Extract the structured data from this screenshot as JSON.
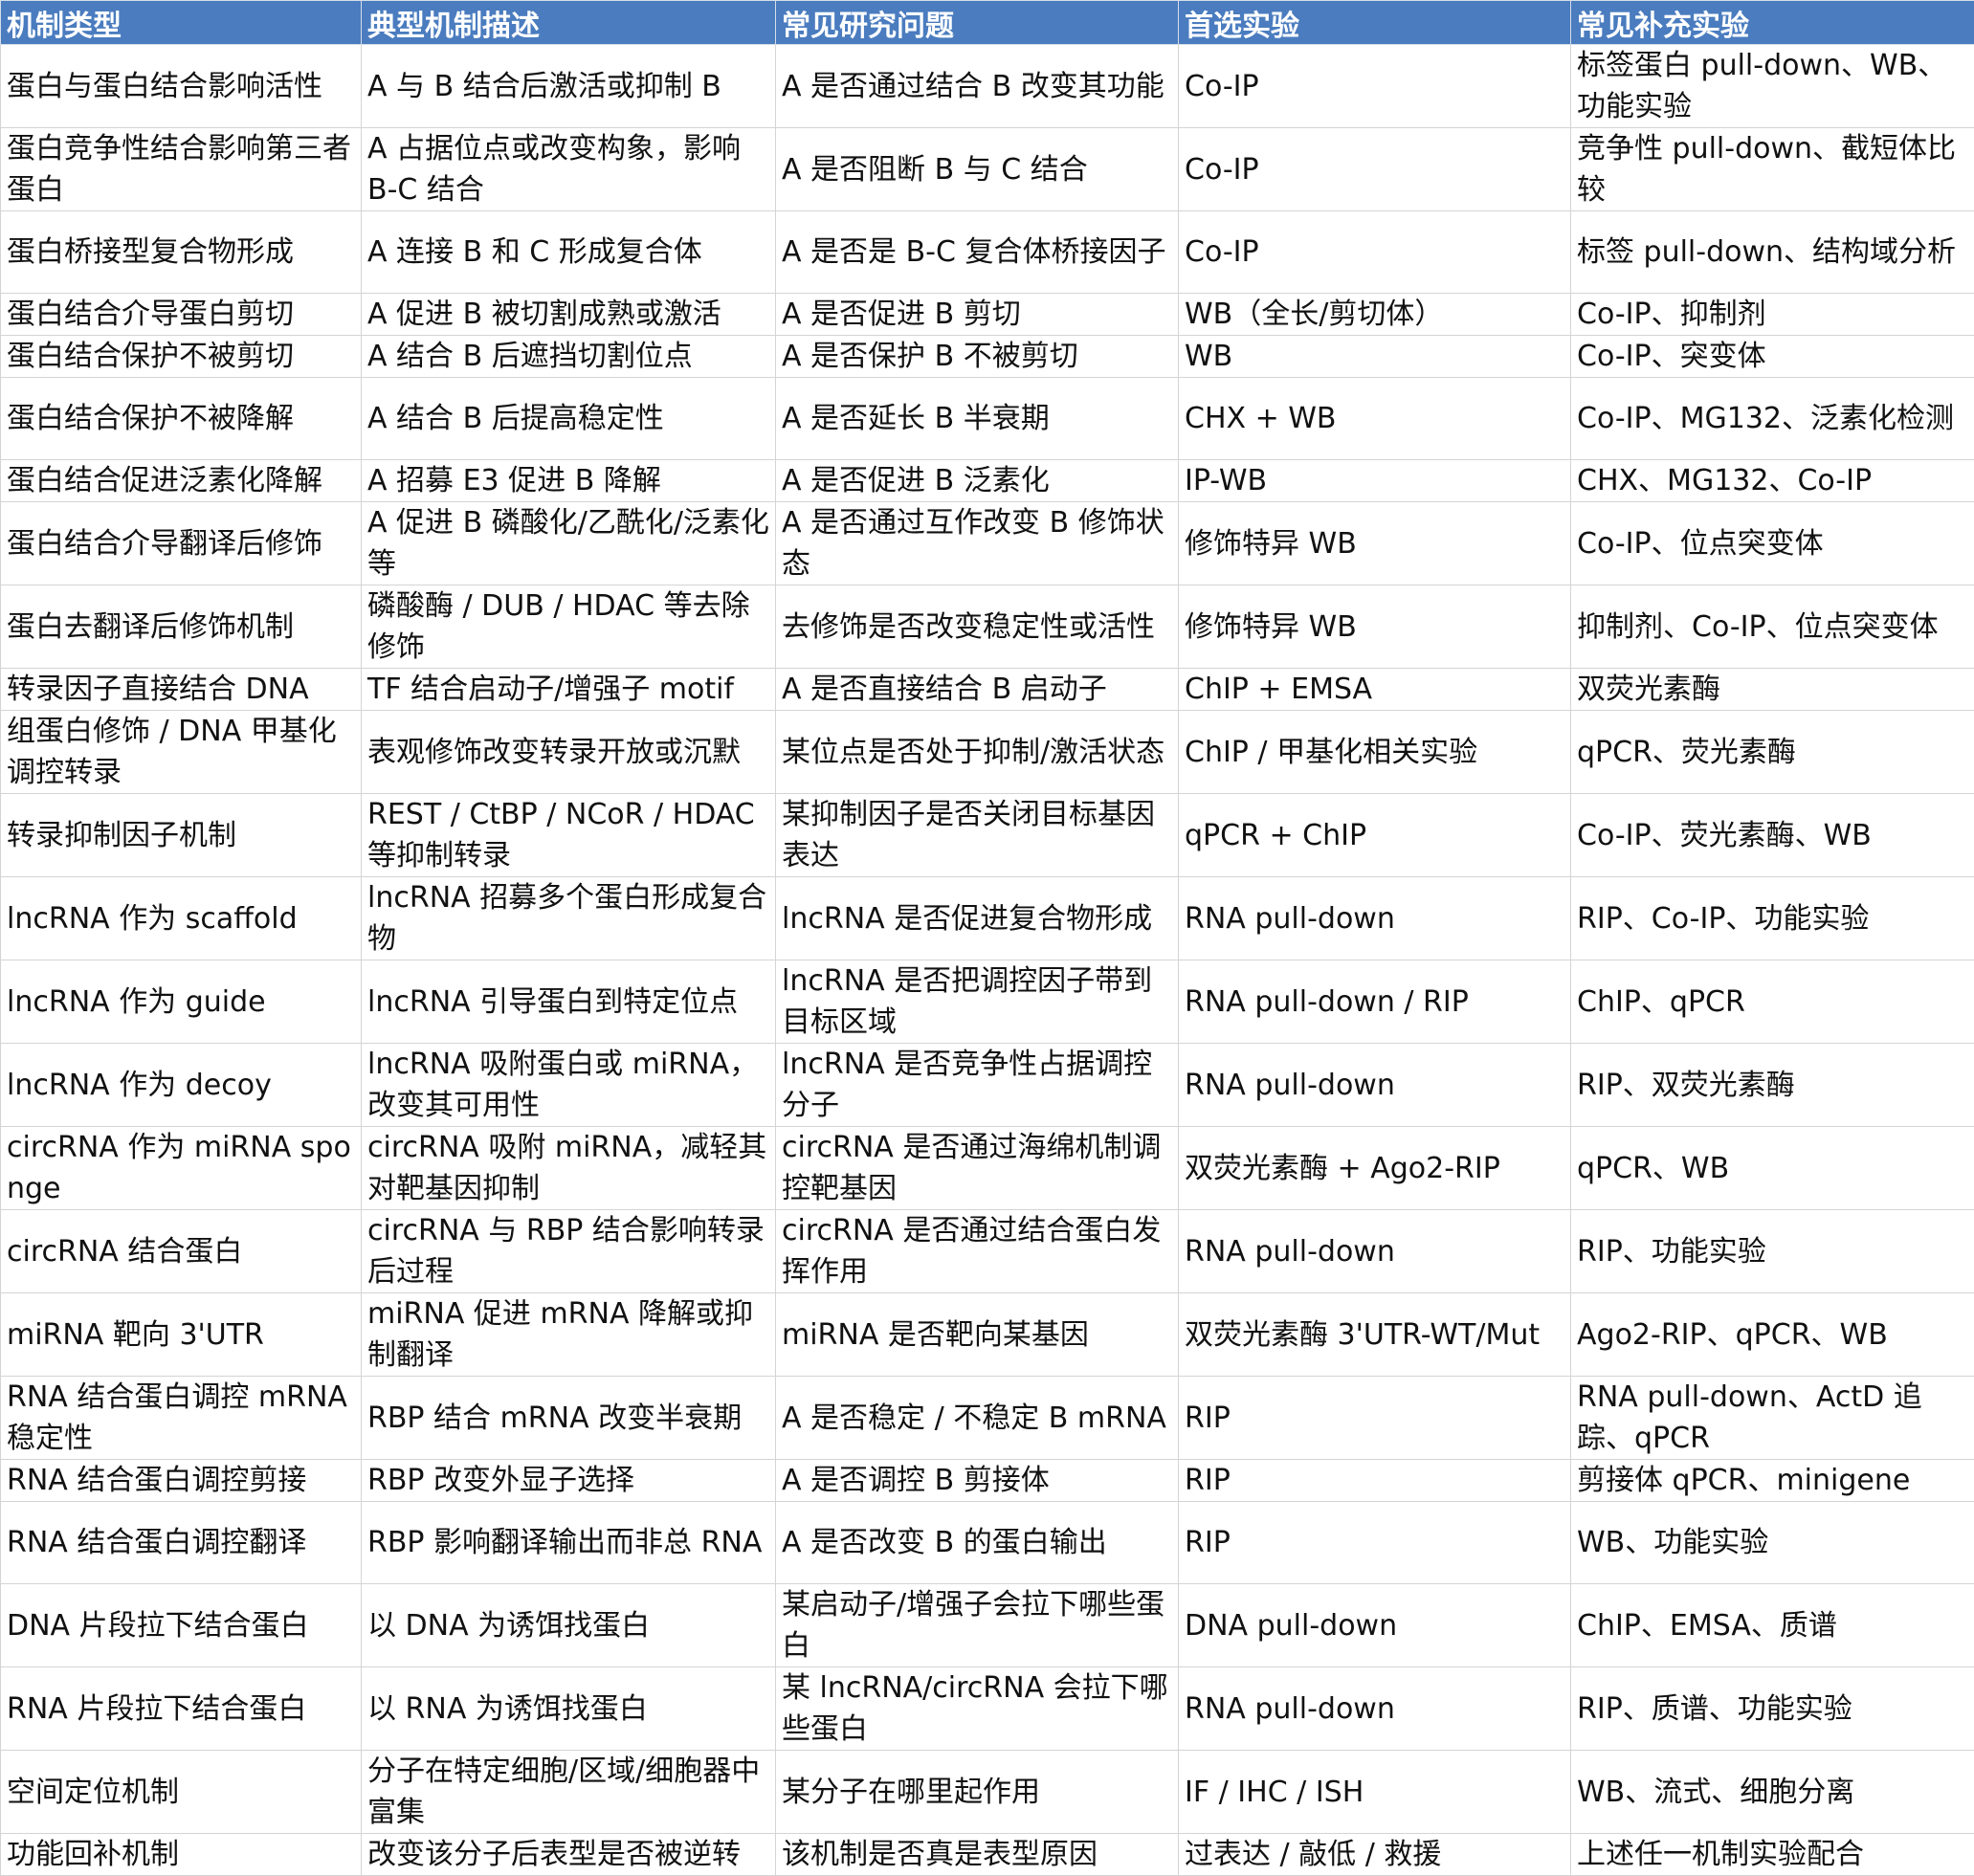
{
  "headers": [
    "机制类型",
    "典型机制描述",
    "常见研究问题",
    "首选实验",
    "常见补充实验"
  ],
  "rows": [
    {
      "type": "蛋白与蛋白结合影响活性",
      "desc": "A 与 B 结合后激活或抑制 B",
      "question": "A 是否通过结合 B 改变其功能",
      "primary": "Co-IP",
      "supplement": "标签蛋白 pull-down、WB、功能实验"
    },
    {
      "type": "蛋白竞争性结合影响第三者蛋白",
      "desc": "A 占据位点或改变构象，影响 B-C 结合",
      "question": "A 是否阻断 B 与 C 结合",
      "primary": "Co-IP",
      "supplement": "竞争性 pull-down、截短体比较"
    },
    {
      "type": "蛋白桥接型复合物形成",
      "desc": "A 连接 B 和 C 形成复合体",
      "question": "A 是否是 B-C 复合体桥接因子",
      "primary": "Co-IP",
      "supplement": "标签 pull-down、结构域分析"
    },
    {
      "type": "蛋白结合介导蛋白剪切",
      "desc": "A 促进 B 被切割成熟或激活",
      "question": "A 是否促进 B 剪切",
      "primary": "WB（全长/剪切体）",
      "supplement": "Co-IP、抑制剂"
    },
    {
      "type": "蛋白结合保护不被剪切",
      "desc": "A 结合 B 后遮挡切割位点",
      "question": "A 是否保护 B 不被剪切",
      "primary": "WB",
      "supplement": "Co-IP、突变体"
    },
    {
      "type": "蛋白结合保护不被降解",
      "desc": "A 结合 B 后提高稳定性",
      "question": "A 是否延长 B 半衰期",
      "primary": "CHX + WB",
      "supplement": "Co-IP、MG132、泛素化检测"
    },
    {
      "type": "蛋白结合促进泛素化降解",
      "desc": "A 招募 E3 促进 B 降解",
      "question": "A 是否促进 B 泛素化",
      "primary": "IP-WB",
      "supplement": "CHX、MG132、Co-IP"
    },
    {
      "type": "蛋白结合介导翻译后修饰",
      "desc": "A 促进 B 磷酸化/乙酰化/泛素化等",
      "question": "A 是否通过互作改变 B 修饰状态",
      "primary": "修饰特异 WB",
      "supplement": "Co-IP、位点突变体"
    },
    {
      "type": "蛋白去翻译后修饰机制",
      "desc": "磷酸酶 / DUB / HDAC 等去除修饰",
      "question": "去修饰是否改变稳定性或活性",
      "primary": "修饰特异 WB",
      "supplement": "抑制剂、Co-IP、位点突变体"
    },
    {
      "type": "转录因子直接结合 DNA",
      "desc": "TF 结合启动子/增强子 motif",
      "question": "A 是否直接结合 B 启动子",
      "primary": "ChIP + EMSA",
      "supplement": "双荧光素酶"
    },
    {
      "type": "组蛋白修饰 / DNA 甲基化调控转录",
      "desc": "表观修饰改变转录开放或沉默",
      "question": "某位点是否处于抑制/激活状态",
      "primary": "ChIP / 甲基化相关实验",
      "supplement": "qPCR、荧光素酶"
    },
    {
      "type": "转录抑制因子机制",
      "desc": "REST / CtBP / NCoR / HDAC 等抑制转录",
      "question": "某抑制因子是否关闭目标基因表达",
      "primary": "qPCR + ChIP",
      "supplement": "Co-IP、荧光素酶、WB"
    },
    {
      "type": "lncRNA 作为 scaffold",
      "desc": "lncRNA 招募多个蛋白形成复合物",
      "question": "lncRNA 是否促进复合物形成",
      "primary": "RNA pull-down",
      "supplement": "RIP、Co-IP、功能实验"
    },
    {
      "type": "lncRNA 作为 guide",
      "desc": "lncRNA 引导蛋白到特定位点",
      "question": "lncRNA 是否把调控因子带到目标区域",
      "primary": "RNA pull-down / RIP",
      "supplement": "ChIP、qPCR"
    },
    {
      "type": "lncRNA 作为 decoy",
      "desc": "lncRNA 吸附蛋白或 miRNA，改变其可用性",
      "question": "lncRNA 是否竞争性占据调控分子",
      "primary": "RNA pull-down",
      "supplement": "RIP、双荧光素酶"
    },
    {
      "type": "circRNA 作为 miRNA sponge",
      "desc": "circRNA 吸附 miRNA，减轻其对靶基因抑制",
      "question": "circRNA 是否通过海绵机制调控靶基因",
      "primary": "双荧光素酶 + Ago2-RIP",
      "supplement": "qPCR、WB"
    },
    {
      "type": "circRNA 结合蛋白",
      "desc": "circRNA 与 RBP 结合影响转录后过程",
      "question": "circRNA 是否通过结合蛋白发挥作用",
      "primary": "RNA pull-down",
      "supplement": "RIP、功能实验"
    },
    {
      "type": "miRNA 靶向 3'UTR",
      "desc": "miRNA 促进 mRNA 降解或抑制翻译",
      "question": "miRNA 是否靶向某基因",
      "primary": "双荧光素酶 3'UTR-WT/Mut",
      "supplement": "Ago2-RIP、qPCR、WB"
    },
    {
      "type": "RNA 结合蛋白调控 mRNA 稳定性",
      "desc": "RBP 结合 mRNA 改变半衰期",
      "question": "A 是否稳定 / 不稳定 B mRNA",
      "primary": "RIP",
      "supplement": "RNA pull-down、ActD 追踪、qPCR"
    },
    {
      "type": "RNA 结合蛋白调控剪接",
      "desc": "RBP 改变外显子选择",
      "question": "A 是否调控 B 剪接体",
      "primary": "RIP",
      "supplement": "剪接体 qPCR、minigene"
    },
    {
      "type": "RNA 结合蛋白调控翻译",
      "desc": "RBP 影响翻译输出而非总 RNA",
      "question": "A 是否改变 B 的蛋白输出",
      "primary": "RIP",
      "supplement": "WB、功能实验"
    },
    {
      "type": "DNA 片段拉下结合蛋白",
      "desc": "以 DNA 为诱饵找蛋白",
      "question": "某启动子/增强子会拉下哪些蛋白",
      "primary": "DNA pull-down",
      "supplement": "ChIP、EMSA、质谱"
    },
    {
      "type": "RNA 片段拉下结合蛋白",
      "desc": "以 RNA 为诱饵找蛋白",
      "question": "某 lncRNA/circRNA 会拉下哪些蛋白",
      "primary": "RNA pull-down",
      "supplement": "RIP、质谱、功能实验"
    },
    {
      "type": "空间定位机制",
      "desc": "分子在特定细胞/区域/细胞器中富集",
      "question": "某分子在哪里起作用",
      "primary": "IF / IHC / ISH",
      "supplement": "WB、流式、细胞分离"
    },
    {
      "type": "功能回补机制",
      "desc": "改变该分子后表型是否被逆转",
      "question": "该机制是否真是表型原因",
      "primary": "过表达 / 敲低 / 救援",
      "supplement": "上述任一机制实验配合"
    }
  ]
}
